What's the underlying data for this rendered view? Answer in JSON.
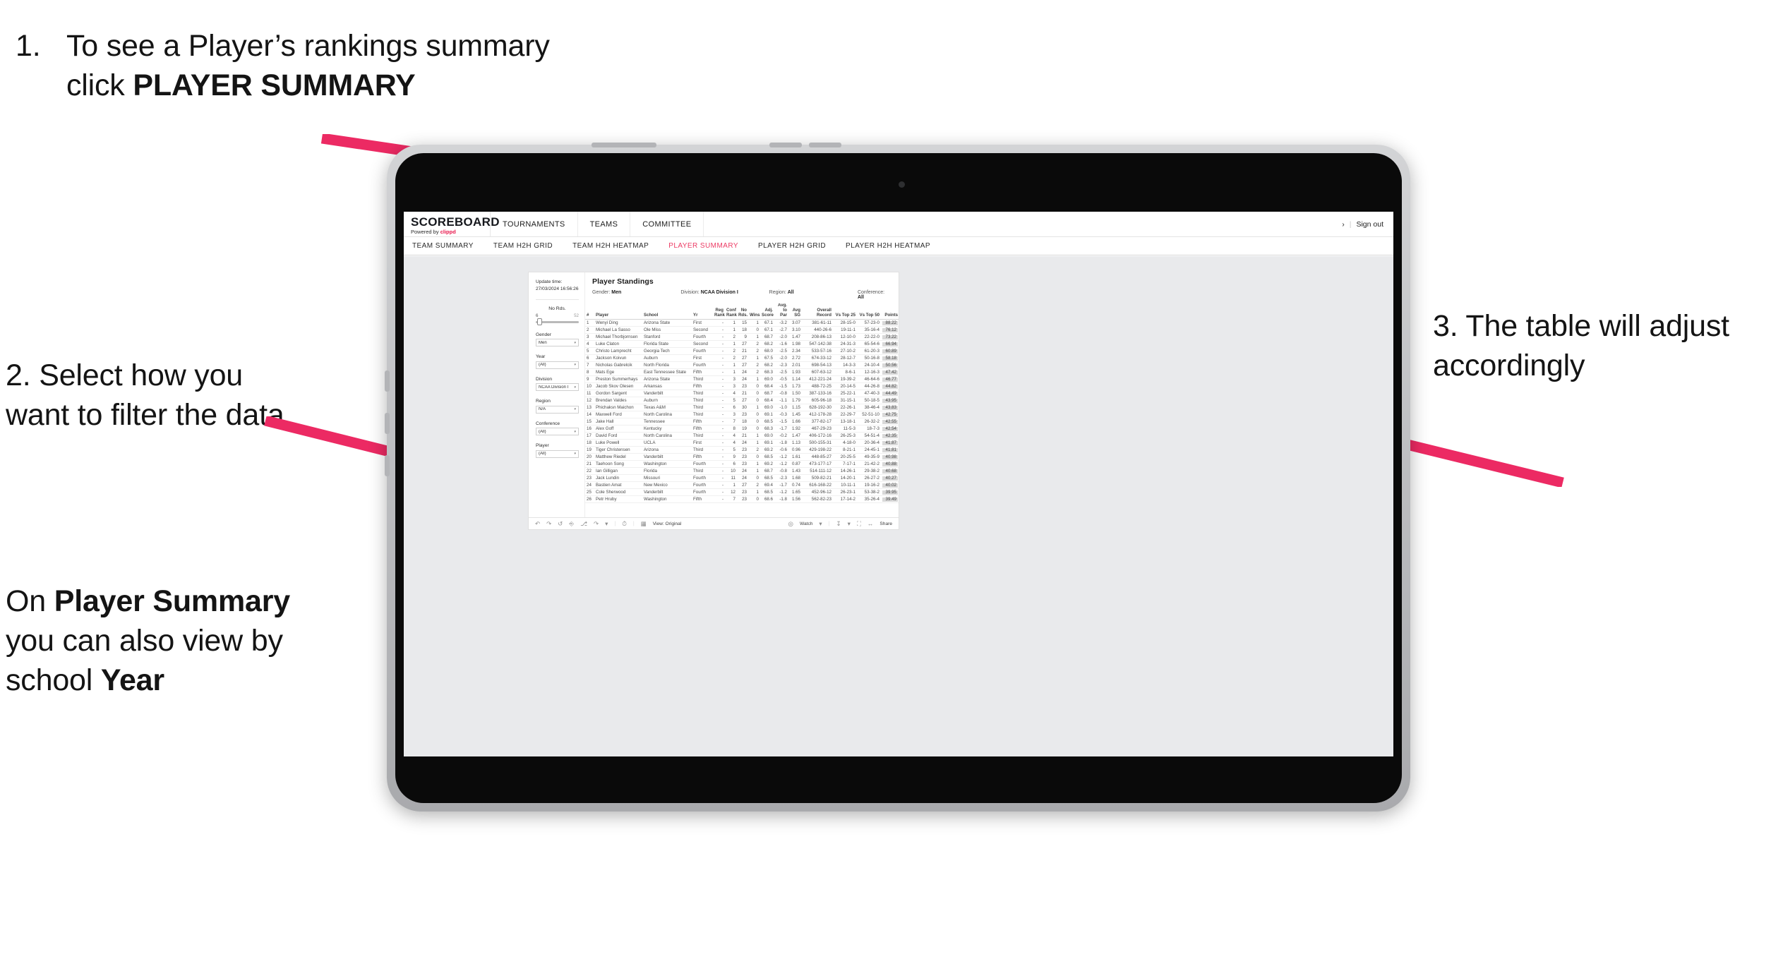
{
  "slide": {
    "annotation_1": {
      "number": "1.",
      "text_parts": [
        {
          "t": "To see a Player’s rankings summary click ",
          "bold": false
        },
        {
          "t": "PLAYER SUMMARY",
          "bold": true
        }
      ],
      "plain": "1. To see a Player’s rankings summary click PLAYER SUMMARY"
    },
    "annotation_2": {
      "plain": "2. Select how you want to filter the data"
    },
    "annotation_3": {
      "text_parts": [
        {
          "t": "On ",
          "bold": false
        },
        {
          "t": "Player Summary",
          "bold": true
        },
        {
          "t": " you can also view by school ",
          "bold": false
        },
        {
          "t": "Year",
          "bold": true
        }
      ],
      "plain": "On Player Summary you can also view by school Year"
    },
    "annotation_4": {
      "plain": "3. The table will adjust accordingly"
    },
    "arrow_color": "#ec2a63"
  },
  "app": {
    "brand": {
      "name": "SCOREBOARD",
      "powered_prefix": "Powered by ",
      "powered_by": "clippd"
    },
    "top_nav": [
      {
        "label": "TOURNAMENTS"
      },
      {
        "label": "TEAMS"
      },
      {
        "label": "COMMITTEE"
      }
    ],
    "account": {
      "user_glyph": "›",
      "separator": "|",
      "sign_out": "Sign out"
    },
    "sub_nav": {
      "active": "PLAYER SUMMARY",
      "tabs": [
        {
          "label": "TEAM SUMMARY"
        },
        {
          "label": "TEAM H2H GRID"
        },
        {
          "label": "TEAM H2H HEATMAP"
        },
        {
          "label": "PLAYER SUMMARY"
        },
        {
          "label": "PLAYER H2H GRID"
        },
        {
          "label": "PLAYER H2H HEATMAP"
        }
      ]
    },
    "accent_color": "#ec3b64",
    "filters": {
      "update_time_label": "Update time:",
      "update_time_value": "27/03/2024 16:56:26",
      "slider": {
        "label": "No Rds.",
        "min": "6",
        "max": "52",
        "value_position_pct": 4
      },
      "selects": [
        {
          "label": "Gender",
          "value": "Men"
        },
        {
          "label": "Year",
          "value": "(All)"
        },
        {
          "label": "Division",
          "value": "NCAA Division I"
        },
        {
          "label": "Region",
          "value": "N/A"
        },
        {
          "label": "Conference",
          "value": "(All)"
        },
        {
          "label": "Player",
          "value": "(All)"
        }
      ],
      "caret": "▾"
    },
    "viz": {
      "title": "Player Standings",
      "summary": [
        {
          "label": "Gender:",
          "value": "Men"
        },
        {
          "label": "Division:",
          "value": "NCAA Division I"
        },
        {
          "label": "Region:",
          "value": "All"
        },
        {
          "label": "Conference:",
          "value": "All"
        }
      ],
      "columns": [
        {
          "key": "rank",
          "label": "#",
          "align": "left"
        },
        {
          "key": "player",
          "label": "Player",
          "align": "left"
        },
        {
          "key": "school",
          "label": "School",
          "align": "left"
        },
        {
          "key": "yr",
          "label": "Yr",
          "align": "left"
        },
        {
          "key": "regrank",
          "label": "Reg\nRank",
          "align": "right"
        },
        {
          "key": "confrank",
          "label": "Conf\nRank",
          "align": "right"
        },
        {
          "key": "nords",
          "label": "No\nRds.",
          "align": "right"
        },
        {
          "key": "wins",
          "label": "Wins",
          "align": "right"
        },
        {
          "key": "adjscore",
          "label": "Adj.\nScore",
          "align": "right"
        },
        {
          "key": "avgpar",
          "label": "Avg.\nto Par",
          "align": "right"
        },
        {
          "key": "avgsg",
          "label": "Avg\nSG",
          "align": "right"
        },
        {
          "key": "overall",
          "label": "Overall\nRecord",
          "align": "right"
        },
        {
          "key": "t25",
          "label": "Vs Top 25",
          "align": "right"
        },
        {
          "key": "t50",
          "label": "Vs Top 50",
          "align": "right"
        },
        {
          "key": "points",
          "label": "Points",
          "align": "right"
        }
      ],
      "rows": [
        {
          "rank": "1",
          "player": "Wenyi Ding",
          "school": "Arizona State",
          "yr": "First",
          "regrank": "-",
          "confrank": "1",
          "nords": "15",
          "wins": "1",
          "adjscore": "67.1",
          "avgpar": "-3.2",
          "avgsg": "3.07",
          "overall": "381-61-11",
          "t25": "28-15-0",
          "t50": "57-23-0",
          "points": "88.22"
        },
        {
          "rank": "2",
          "player": "Michael La Sasso",
          "school": "Ole Miss",
          "yr": "Second",
          "regrank": "-",
          "confrank": "1",
          "nords": "18",
          "wins": "0",
          "adjscore": "67.1",
          "avgpar": "-2.7",
          "avgsg": "3.10",
          "overall": "440-26-6",
          "t25": "19-11-1",
          "t50": "35-16-4",
          "points": "76.12"
        },
        {
          "rank": "3",
          "player": "Michael Thorbjornsen",
          "school": "Stanford",
          "yr": "Fourth",
          "regrank": "-",
          "confrank": "2",
          "nords": "9",
          "wins": "1",
          "adjscore": "68.7",
          "avgpar": "-2.0",
          "avgsg": "1.47",
          "overall": "208-86-13",
          "t25": "12-10-0",
          "t50": "22-22-0",
          "points": "73.22"
        },
        {
          "rank": "4",
          "player": "Luke Claton",
          "school": "Florida State",
          "yr": "Second",
          "regrank": "-",
          "confrank": "1",
          "nords": "27",
          "wins": "2",
          "adjscore": "68.2",
          "avgpar": "-1.6",
          "avgsg": "1.98",
          "overall": "547-142-38",
          "t25": "24-31-3",
          "t50": "65-54-6",
          "points": "66.94"
        },
        {
          "rank": "5",
          "player": "Christo Lamprecht",
          "school": "Georgia Tech",
          "yr": "Fourth",
          "regrank": "-",
          "confrank": "2",
          "nords": "21",
          "wins": "2",
          "adjscore": "68.0",
          "avgpar": "-2.5",
          "avgsg": "2.34",
          "overall": "533-57-16",
          "t25": "27-10-2",
          "t50": "61-20-3",
          "points": "60.89"
        },
        {
          "rank": "6",
          "player": "Jackson Koivun",
          "school": "Auburn",
          "yr": "First",
          "regrank": "-",
          "confrank": "2",
          "nords": "27",
          "wins": "1",
          "adjscore": "67.5",
          "avgpar": "-2.0",
          "avgsg": "2.72",
          "overall": "674-33-12",
          "t25": "28-12-7",
          "t50": "50-16-8",
          "points": "58.18"
        },
        {
          "rank": "7",
          "player": "Nicholas Gabrelcik",
          "school": "North Florida",
          "yr": "Fourth",
          "regrank": "-",
          "confrank": "1",
          "nords": "27",
          "wins": "2",
          "adjscore": "68.2",
          "avgpar": "-2.3",
          "avgsg": "2.01",
          "overall": "698-54-13",
          "t25": "14-3-3",
          "t50": "24-10-4",
          "points": "50.56"
        },
        {
          "rank": "8",
          "player": "Mats Ege",
          "school": "East Tennessee State",
          "yr": "Fifth",
          "regrank": "-",
          "confrank": "1",
          "nords": "24",
          "wins": "2",
          "adjscore": "68.3",
          "avgpar": "-2.5",
          "avgsg": "1.93",
          "overall": "607-63-12",
          "t25": "8-6-1",
          "t50": "12-16-3",
          "points": "47.42"
        },
        {
          "rank": "9",
          "player": "Preston Summerhays",
          "school": "Arizona State",
          "yr": "Third",
          "regrank": "-",
          "confrank": "3",
          "nords": "24",
          "wins": "1",
          "adjscore": "69.0",
          "avgpar": "-0.5",
          "avgsg": "1.14",
          "overall": "412-221-24",
          "t25": "19-39-2",
          "t50": "46-64-6",
          "points": "46.77"
        },
        {
          "rank": "10",
          "player": "Jacob Skov Olesen",
          "school": "Arkansas",
          "yr": "Fifth",
          "regrank": "-",
          "confrank": "3",
          "nords": "23",
          "wins": "0",
          "adjscore": "68.4",
          "avgpar": "-1.5",
          "avgsg": "1.73",
          "overall": "488-72-25",
          "t25": "20-14-5",
          "t50": "44-26-8",
          "points": "44.82"
        },
        {
          "rank": "11",
          "player": "Gordon Sargent",
          "school": "Vanderbilt",
          "yr": "Third",
          "regrank": "-",
          "confrank": "4",
          "nords": "21",
          "wins": "0",
          "adjscore": "68.7",
          "avgpar": "-0.8",
          "avgsg": "1.50",
          "overall": "387-133-16",
          "t25": "25-22-1",
          "t50": "47-40-3",
          "points": "44.49"
        },
        {
          "rank": "12",
          "player": "Brendan Valdes",
          "school": "Auburn",
          "yr": "Third",
          "regrank": "-",
          "confrank": "5",
          "nords": "27",
          "wins": "0",
          "adjscore": "68.4",
          "avgpar": "-1.1",
          "avgsg": "1.79",
          "overall": "605-96-18",
          "t25": "31-15-1",
          "t50": "50-18-5",
          "points": "43.95"
        },
        {
          "rank": "13",
          "player": "Phichaksn Maichon",
          "school": "Texas A&M",
          "yr": "Third",
          "regrank": "-",
          "confrank": "6",
          "nords": "30",
          "wins": "1",
          "adjscore": "69.0",
          "avgpar": "-1.0",
          "avgsg": "1.15",
          "overall": "628-192-30",
          "t25": "22-26-1",
          "t50": "38-46-4",
          "points": "43.83"
        },
        {
          "rank": "14",
          "player": "Maxwell Ford",
          "school": "North Carolina",
          "yr": "Third",
          "regrank": "-",
          "confrank": "3",
          "nords": "23",
          "wins": "0",
          "adjscore": "69.1",
          "avgpar": "-0.3",
          "avgsg": "1.45",
          "overall": "412-178-28",
          "t25": "22-29-7",
          "t50": "52-51-10",
          "points": "42.75"
        },
        {
          "rank": "15",
          "player": "Jake Hall",
          "school": "Tennessee",
          "yr": "Fifth",
          "regrank": "-",
          "confrank": "7",
          "nords": "18",
          "wins": "0",
          "adjscore": "68.5",
          "avgpar": "-1.5",
          "avgsg": "1.66",
          "overall": "377-82-17",
          "t25": "13-18-1",
          "t50": "26-32-2",
          "points": "42.55"
        },
        {
          "rank": "16",
          "player": "Alex Goff",
          "school": "Kentucky",
          "yr": "Fifth",
          "regrank": "-",
          "confrank": "8",
          "nords": "19",
          "wins": "0",
          "adjscore": "68.3",
          "avgpar": "-1.7",
          "avgsg": "1.92",
          "overall": "467-29-23",
          "t25": "11-5-3",
          "t50": "18-7-3",
          "points": "42.54"
        },
        {
          "rank": "17",
          "player": "David Ford",
          "school": "North Carolina",
          "yr": "Third",
          "regrank": "-",
          "confrank": "4",
          "nords": "21",
          "wins": "1",
          "adjscore": "69.0",
          "avgpar": "-0.2",
          "avgsg": "1.47",
          "overall": "406-172-16",
          "t25": "26-25-3",
          "t50": "54-51-4",
          "points": "42.35"
        },
        {
          "rank": "18",
          "player": "Luke Powell",
          "school": "UCLA",
          "yr": "First",
          "regrank": "-",
          "confrank": "4",
          "nords": "24",
          "wins": "1",
          "adjscore": "69.1",
          "avgpar": "-1.8",
          "avgsg": "1.13",
          "overall": "500-155-31",
          "t25": "4-18-0",
          "t50": "20-36-4",
          "points": "41.87"
        },
        {
          "rank": "19",
          "player": "Tiger Christensen",
          "school": "Arizona",
          "yr": "Third",
          "regrank": "-",
          "confrank": "5",
          "nords": "23",
          "wins": "2",
          "adjscore": "69.2",
          "avgpar": "-0.6",
          "avgsg": "0.96",
          "overall": "429-198-22",
          "t25": "8-21-1",
          "t50": "24-45-1",
          "points": "41.81"
        },
        {
          "rank": "20",
          "player": "Matthew Riedel",
          "school": "Vanderbilt",
          "yr": "Fifth",
          "regrank": "-",
          "confrank": "9",
          "nords": "23",
          "wins": "0",
          "adjscore": "68.5",
          "avgpar": "-1.2",
          "avgsg": "1.61",
          "overall": "448-85-27",
          "t25": "20-25-5",
          "t50": "49-35-9",
          "points": "40.98"
        },
        {
          "rank": "21",
          "player": "Taehoon Song",
          "school": "Washington",
          "yr": "Fourth",
          "regrank": "-",
          "confrank": "6",
          "nords": "23",
          "wins": "1",
          "adjscore": "69.2",
          "avgpar": "-1.2",
          "avgsg": "0.87",
          "overall": "473-177-17",
          "t25": "7-17-1",
          "t50": "21-42-2",
          "points": "40.88"
        },
        {
          "rank": "22",
          "player": "Ian Gilligan",
          "school": "Florida",
          "yr": "Third",
          "regrank": "-",
          "confrank": "10",
          "nords": "24",
          "wins": "1",
          "adjscore": "68.7",
          "avgpar": "-0.8",
          "avgsg": "1.43",
          "overall": "514-111-12",
          "t25": "14-26-1",
          "t50": "29-38-2",
          "points": "40.68"
        },
        {
          "rank": "23",
          "player": "Jack Lundin",
          "school": "Missouri",
          "yr": "Fourth",
          "regrank": "-",
          "confrank": "11",
          "nords": "24",
          "wins": "0",
          "adjscore": "68.5",
          "avgpar": "-2.3",
          "avgsg": "1.68",
          "overall": "509-82-21",
          "t25": "14-20-1",
          "t50": "26-27-2",
          "points": "40.27"
        },
        {
          "rank": "24",
          "player": "Bastien Amat",
          "school": "New Mexico",
          "yr": "Fourth",
          "regrank": "-",
          "confrank": "1",
          "nords": "27",
          "wins": "2",
          "adjscore": "69.4",
          "avgpar": "-1.7",
          "avgsg": "0.74",
          "overall": "616-168-22",
          "t25": "10-11-1",
          "t50": "19-16-2",
          "points": "40.02"
        },
        {
          "rank": "25",
          "player": "Cole Sherwood",
          "school": "Vanderbilt",
          "yr": "Fourth",
          "regrank": "-",
          "confrank": "12",
          "nords": "23",
          "wins": "1",
          "adjscore": "68.5",
          "avgpar": "-1.2",
          "avgsg": "1.65",
          "overall": "452-96-12",
          "t25": "26-23-1",
          "t50": "53-38-2",
          "points": "39.95"
        },
        {
          "rank": "26",
          "player": "Petr Hruby",
          "school": "Washington",
          "yr": "Fifth",
          "regrank": "-",
          "confrank": "7",
          "nords": "23",
          "wins": "0",
          "adjscore": "68.6",
          "avgpar": "-1.8",
          "avgsg": "1.56",
          "overall": "562-82-23",
          "t25": "17-14-2",
          "t50": "35-26-4",
          "points": "39.49"
        }
      ]
    },
    "toolbar": {
      "view_label": "View: Original",
      "watch_label": "Watch",
      "share_label": "Share",
      "caret": "▾",
      "separator": "|"
    }
  }
}
